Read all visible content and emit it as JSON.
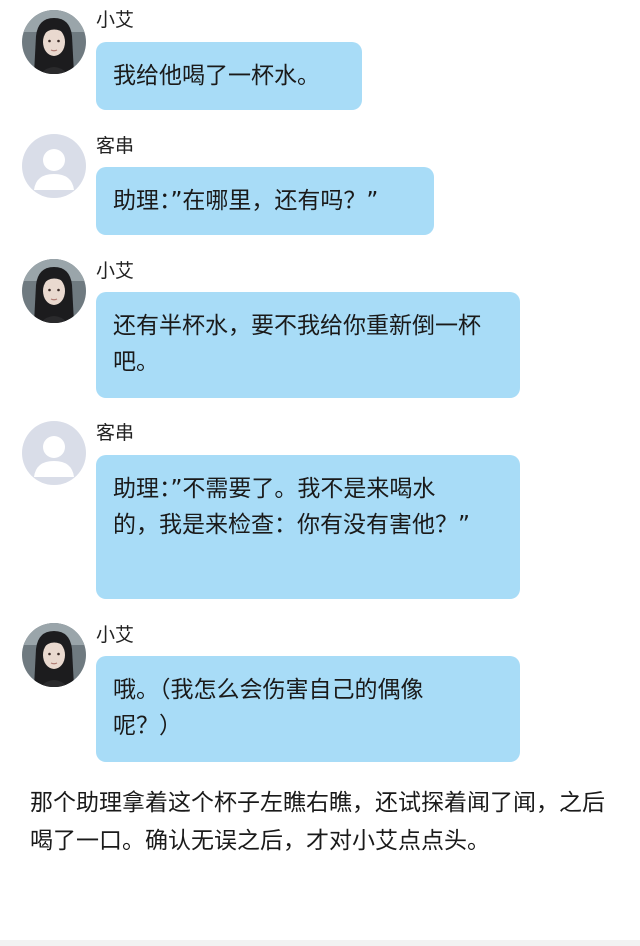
{
  "messages": [
    {
      "speaker": "小艾",
      "avatar": "girl-avatar-icon",
      "text": "我给他喝了一杯水。"
    },
    {
      "speaker": "客串",
      "avatar": "default-user-icon",
      "text": "助理：”在哪里，还有吗？”"
    },
    {
      "speaker": "小艾",
      "avatar": "girl-avatar-icon",
      "text": "还有半杯水，要不我给你重新倒一杯吧。"
    },
    {
      "speaker": "客串",
      "avatar": "default-user-icon",
      "text": "助理：”不需要了。我不是来喝水的，我是来检查：你有没有害他？”"
    },
    {
      "speaker": "小艾",
      "avatar": "girl-avatar-icon",
      "text": "哦。（我怎么会伤害自己的偶像呢？）"
    }
  ],
  "narration": "那个助理拿着这个杯子左瞧右瞧，还试探着闻了闻，之后喝了一口。确认无误之后，才对小艾点点头。",
  "colors": {
    "bubble": "#a8dcf7",
    "background": "#ffffff",
    "default_avatar_bg": "#d9dde8",
    "default_avatar_fg": "#ffffff"
  }
}
